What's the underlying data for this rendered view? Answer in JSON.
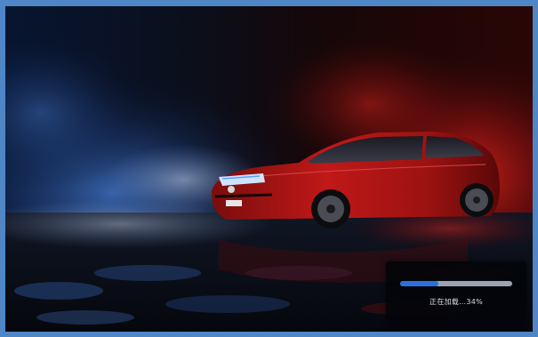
{
  "loading": {
    "status_text": "正在加载…34%",
    "progress_fraction": 0.34,
    "accent_color": "#2d6fe0"
  },
  "icons": {
    "background": "car-showcase-image"
  }
}
